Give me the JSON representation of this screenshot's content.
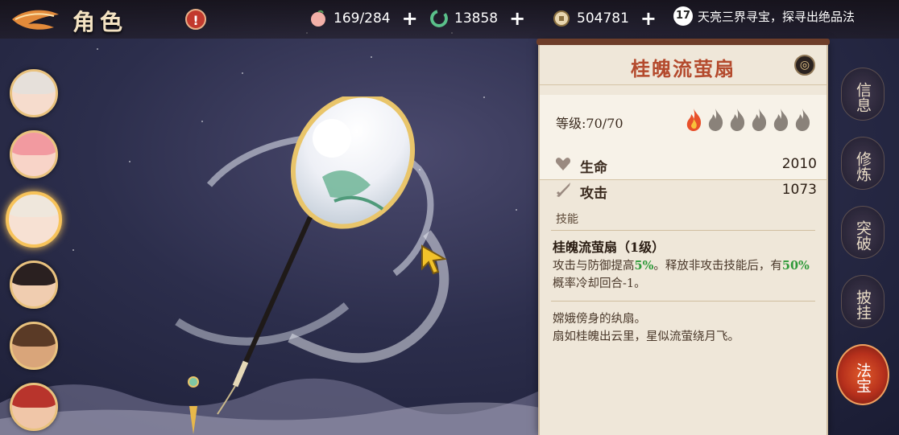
{
  "header": {
    "title": "角色",
    "alert": "!",
    "resources": [
      {
        "name": "stamina",
        "icon": "peach-icon",
        "value": "169/284",
        "color": "#f2b0a8"
      },
      {
        "name": "spirit",
        "icon": "swirl-icon",
        "value": "13858",
        "color": "#5ac08a"
      },
      {
        "name": "coins",
        "icon": "coin-icon",
        "value": "504781",
        "color": "#e8d6b0"
      }
    ],
    "plus": "+",
    "quest": {
      "badge": "17",
      "text": "天亮三界寻宝，探寻出绝品法"
    }
  },
  "characters": [
    {
      "name": "char-1",
      "hair": "#e6e0da",
      "face": "#f6dccd",
      "selected": false
    },
    {
      "name": "char-2",
      "hair": "#f29aa0",
      "face": "#f8d4c8",
      "selected": false
    },
    {
      "name": "char-3",
      "hair": "#efe7dc",
      "face": "#f7e1d3",
      "selected": true
    },
    {
      "name": "char-4",
      "hair": "#2a2020",
      "face": "#f0cdb0",
      "selected": false
    },
    {
      "name": "char-5",
      "hair": "#5a3a26",
      "face": "#d9a57a",
      "selected": false
    },
    {
      "name": "char-6",
      "hair": "#b8342c",
      "face": "#f0c6a8",
      "selected": false
    }
  ],
  "item": {
    "name": "桂魄流萤扇",
    "header_icon": "◎",
    "level_label": "等级:70/70",
    "flames": {
      "filled": 1,
      "total": 6
    },
    "stats": [
      {
        "icon": "heart-icon",
        "label": "生命",
        "value": "2010"
      },
      {
        "icon": "sword-icon",
        "label": "攻击",
        "value": "1073"
      }
    ],
    "skill_section": "技能",
    "skill_name": "桂魄流萤扇（1级）",
    "skill_desc_parts": [
      "攻击与防御提高",
      "5%",
      "。释放非攻击技能后，有",
      "50%",
      "概率冷却回合-1。"
    ],
    "lore_lines": [
      "嫦娥傍身的纨扇。",
      "扇如桂魄出云里，星似流萤绕月飞。"
    ]
  },
  "side_nav": [
    {
      "label": "信息",
      "active": false
    },
    {
      "label": "修炼",
      "active": false
    },
    {
      "label": "突破",
      "active": false
    },
    {
      "label": "披挂",
      "active": false
    },
    {
      "label": "法宝",
      "active": true
    }
  ],
  "colors": {
    "accent": "#b44a2d",
    "highlight": "#2f9a3a",
    "panel_bg": "#efe7d9",
    "flame_active": "#e8502a",
    "flame_inactive": "#8a827a"
  }
}
